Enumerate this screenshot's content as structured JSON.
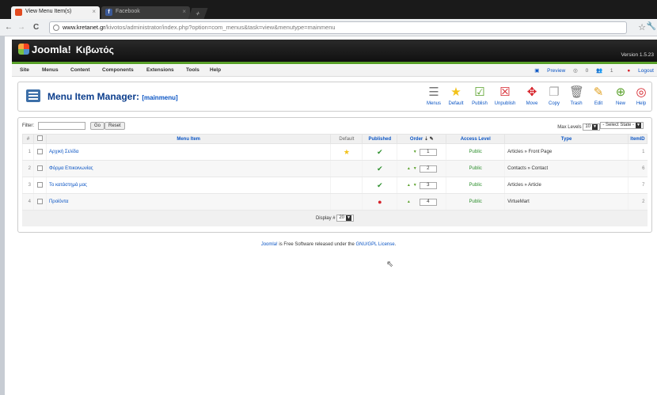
{
  "browser": {
    "tabs": [
      {
        "title": "View Menu Item(s)",
        "active": true
      },
      {
        "title": "Facebook",
        "active": false
      }
    ],
    "url_prefix": "www.kretanet.gr",
    "url_path": "/kivotos/administrator/index.php?option=com_menus&task=view&menutype=mainmenu"
  },
  "header": {
    "logo_text": "Joomla!",
    "site_name": "Κιβωτός",
    "version": "Version 1.5.23"
  },
  "menu": {
    "items": [
      "Site",
      "Menus",
      "Content",
      "Components",
      "Extensions",
      "Tools",
      "Help"
    ],
    "preview": "Preview",
    "messages": "0",
    "users": "1",
    "logout": "Logout"
  },
  "page": {
    "title": "Menu Item Manager:",
    "subtitle": "[mainmenu]"
  },
  "toolbar": [
    "Menus",
    "Default",
    "Publish",
    "Unpublish",
    "Move",
    "Copy",
    "Trash",
    "Edit",
    "New",
    "Help"
  ],
  "filter": {
    "label": "Filter:",
    "value": "",
    "go": "Go",
    "reset": "Reset",
    "max_levels_label": "Max Levels",
    "max_levels_value": "10",
    "state_value": "- Select State -"
  },
  "table": {
    "headers": [
      "#",
      "",
      "Menu Item",
      "Default",
      "Published",
      "Order",
      "Access Level",
      "Type",
      "ItemID"
    ],
    "rows": [
      {
        "num": "1",
        "name": "Αρχική Σελίδα",
        "default": true,
        "published": true,
        "up": false,
        "down": true,
        "order": "1",
        "access": "Public",
        "type": "Articles » Front Page",
        "itemid": "1"
      },
      {
        "num": "2",
        "name": "Φόρμα Επικοινωνίας",
        "default": false,
        "published": true,
        "up": true,
        "down": true,
        "order": "2",
        "access": "Public",
        "type": "Contacts » Contact",
        "itemid": "6"
      },
      {
        "num": "3",
        "name": "Το κατάστημά μας",
        "default": false,
        "published": true,
        "up": true,
        "down": true,
        "order": "3",
        "access": "Public",
        "type": "Articles » Article",
        "itemid": "7"
      },
      {
        "num": "4",
        "name": "Προϊόντα",
        "default": false,
        "published": false,
        "up": true,
        "down": false,
        "order": "4",
        "access": "Public",
        "type": "VirtueMart",
        "itemid": "2"
      }
    ],
    "display_label": "Display #",
    "display_value": "20"
  },
  "footer": {
    "joomla": "Joomla!",
    "text1": " is Free Software released under the ",
    "license": "GNU/GPL License",
    "text2": "."
  }
}
